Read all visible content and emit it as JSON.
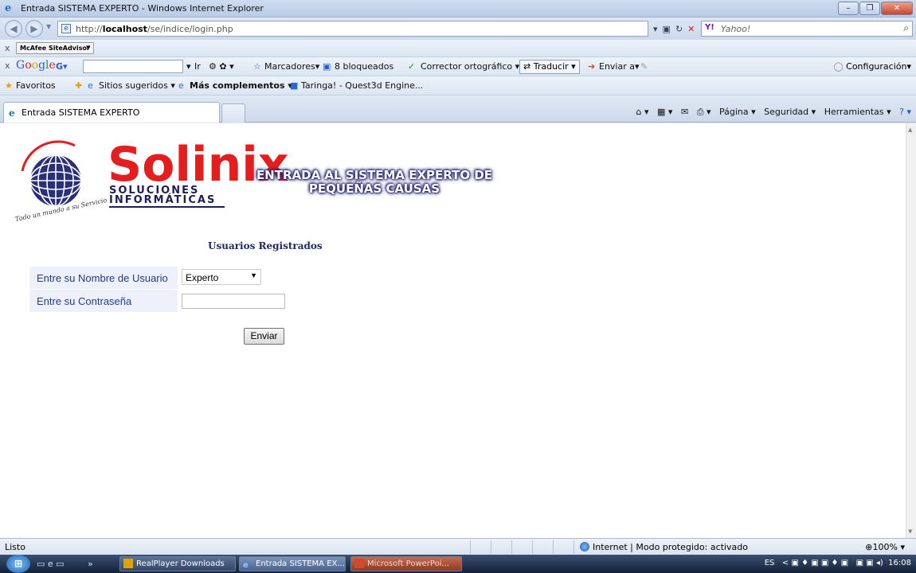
{
  "window": {
    "title": "Entrada SISTEMA EXPERTO - Windows Internet Explorer",
    "buttons": [
      "–",
      "❐",
      "✕"
    ]
  },
  "address_bar": {
    "url_prefix": "http://",
    "url_host": "localhost",
    "url_path": "/se/indice/login.php",
    "search_provider": "Yahoo!"
  },
  "toolbar1": {
    "close": "x",
    "mcafee": "McAfee SiteAdvisor"
  },
  "toolbar2": {
    "close": "x",
    "google_logo": "Google",
    "google_g": "G▾",
    "ir": "Ir",
    "marcadores": "Marcadores▾",
    "bloqueados": "8 bloqueados",
    "corrector": "Corrector ortográfico ▾",
    "traducir": "Traducir",
    "enviar": "Enviar a▾",
    "configuracion": "Configuración▾"
  },
  "favorites_bar": {
    "favoritos": "Favoritos",
    "sitios": "Sitios sugeridos ▾",
    "complementos": "Más complementos ▾",
    "taringa": "Taringa! - Quest3d Engine..."
  },
  "tabs": [
    {
      "label": "Entrada SISTEMA EXPERTO",
      "active": true
    }
  ],
  "command_bar": {
    "pagina": "Página ▾",
    "seguridad": "Seguridad ▾",
    "herramientas": "Herramientas ▾"
  },
  "page": {
    "brand": "Solinix",
    "brand_sub1": "SOLUCIONES",
    "brand_sub2": "INFORMÁTICAS",
    "logo_arc_text": "solinix",
    "slogan": "Todo un mundo a su Servicio",
    "banner_line1": "ENTRADA AL SISTEMA EXPERTO DE",
    "banner_line2": "PEQUEÑAS CAUSAS",
    "heading": "Usuarios Registrados",
    "username_label": "Entre su Nombre de Usuario",
    "username_value": "Experto",
    "password_label": "Entre su Contraseña",
    "password_value": "",
    "submit_label": "Enviar"
  },
  "status_bar": {
    "status": "Listo",
    "zone": "Internet | Modo protegido: activado",
    "zoom": "100%"
  },
  "taskbar": {
    "items": [
      {
        "label": "RealPlayer Downloads",
        "active": false
      },
      {
        "label": "Entrada SISTEMA EX...",
        "active": true
      },
      {
        "label": "Microsoft PowerPoi...",
        "active": false
      }
    ],
    "lang": "ES",
    "clock": "16:08"
  },
  "colors": {
    "brand_red": "#e41e1e",
    "brand_navy": "#1b1f5c",
    "label_blue": "#1f3c8f",
    "form_row_bg": "#eef0fb"
  }
}
